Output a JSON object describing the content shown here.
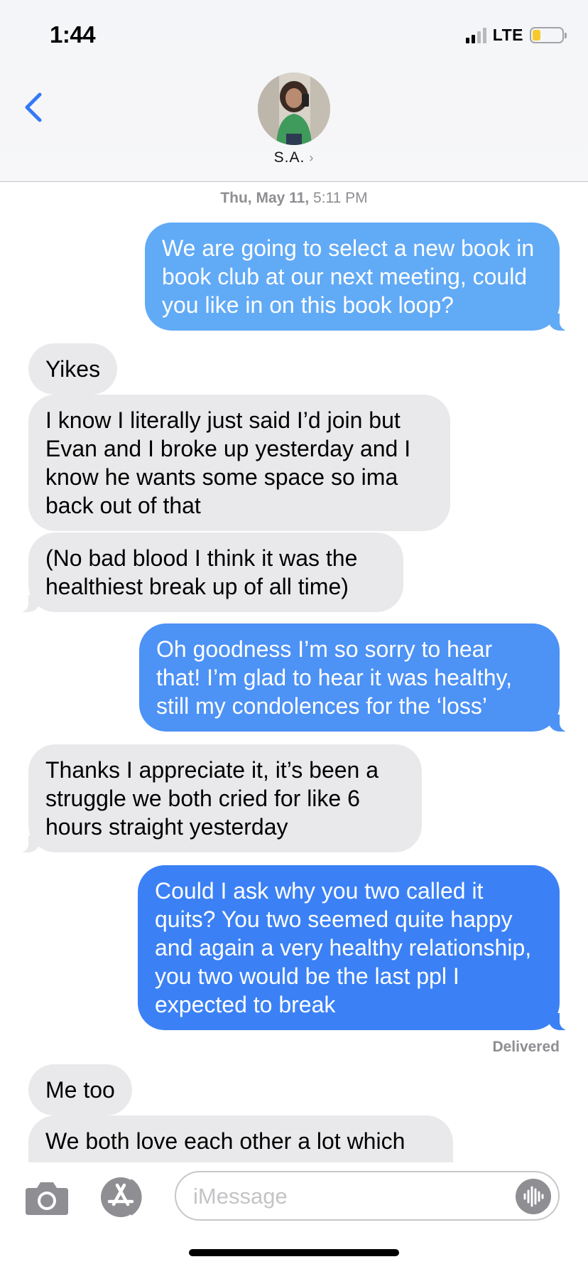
{
  "status_bar": {
    "time": "1:44",
    "network": "LTE",
    "battery_level": 0.25,
    "battery_color": "#f7c92c"
  },
  "nav": {
    "back_icon": "chevron-left-icon",
    "contact_name": "S.A.",
    "contact_chevron": "›",
    "accent_color": "#3478f6"
  },
  "thread": {
    "timestamp_day": "Thu, May 11,",
    "timestamp_time": "5:11 PM",
    "delivered_label": "Delivered",
    "messages": [
      {
        "direction": "out",
        "text": "We are going to select a new book in book club at our next meeting, could you like in on this book loop?"
      },
      {
        "direction": "in",
        "text": "Yikes"
      },
      {
        "direction": "in",
        "text": "I know I literally just said I’d join but Evan and I broke up yesterday and I know he wants some space so ima back out of that"
      },
      {
        "direction": "in",
        "text": "(No bad blood I think it was the healthiest break up of all time)"
      },
      {
        "direction": "out",
        "text": "Oh goodness I’m so sorry to hear that! I’m glad to hear it was healthy, still my condolences for the ‘loss’"
      },
      {
        "direction": "in",
        "text": "Thanks I appreciate it, it’s been a struggle we both cried for like 6 hours straight yesterday"
      },
      {
        "direction": "out",
        "text": "Could I ask why you two called it quits? You two seemed quite happy and again a very healthy relationship, you two would be the last ppl I expected to break"
      },
      {
        "direction": "in",
        "text": "Me too"
      },
      {
        "direction": "in",
        "text": "We both love each other a lot which"
      }
    ]
  },
  "compose": {
    "placeholder": "iMessage",
    "camera_icon": "camera-icon",
    "apps_icon": "app-store-icon",
    "audio_icon": "audio-waveform-icon"
  },
  "colors": {
    "incoming_bubble": "#e9e9eb",
    "outgoing_bubble_top": "#60a9f6",
    "outgoing_bubble_bottom": "#3a80f5"
  }
}
